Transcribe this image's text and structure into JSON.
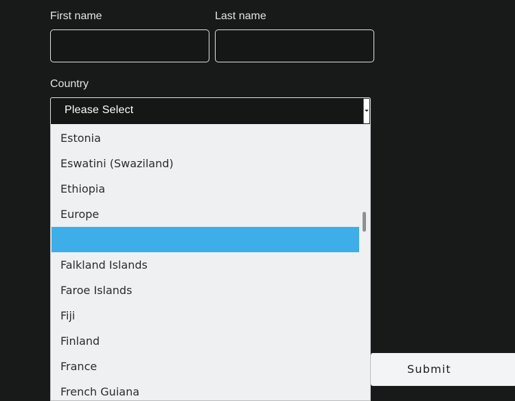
{
  "form": {
    "first_name": {
      "label": "First name",
      "value": ""
    },
    "last_name": {
      "label": "Last name",
      "value": ""
    },
    "country": {
      "label": "Country",
      "selected": "Please Select",
      "scroll_position_fraction": 0.36,
      "options": [
        {
          "label": "Estonia",
          "highlighted": false
        },
        {
          "label": "Eswatini (Swaziland)",
          "highlighted": false
        },
        {
          "label": "Ethiopia",
          "highlighted": false
        },
        {
          "label": "Europe",
          "highlighted": false
        },
        {
          "label": "",
          "highlighted": true
        },
        {
          "label": "Falkland Islands",
          "highlighted": false
        },
        {
          "label": "Faroe Islands",
          "highlighted": false
        },
        {
          "label": "Fiji",
          "highlighted": false
        },
        {
          "label": "Finland",
          "highlighted": false
        },
        {
          "label": "France",
          "highlighted": false
        },
        {
          "label": "French Guiana",
          "highlighted": false
        }
      ]
    },
    "submit_label": "Submit"
  },
  "colors": {
    "page_background": "#181919",
    "highlight": "#3daee9",
    "dropdown_background": "#eff0f1"
  }
}
